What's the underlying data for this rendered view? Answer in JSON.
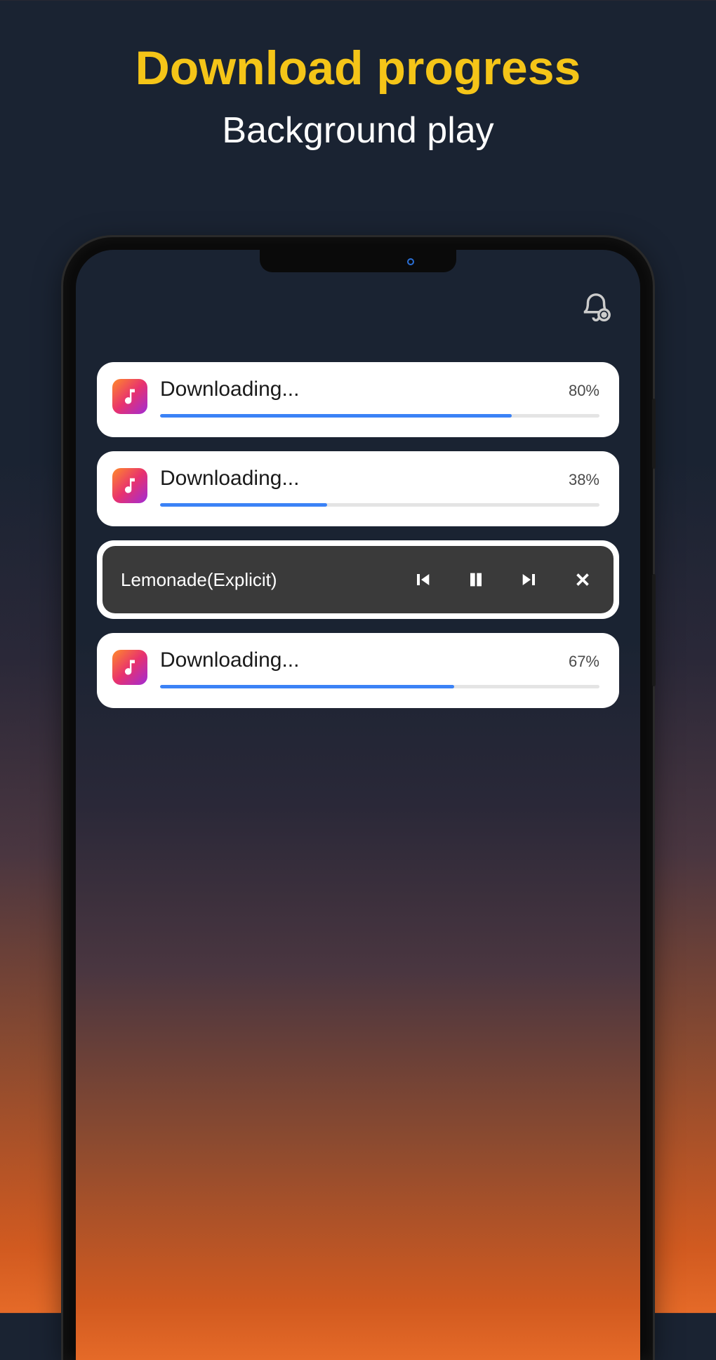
{
  "hero": {
    "title": "Download progress",
    "subtitle": "Background play"
  },
  "downloads": [
    {
      "label": "Downloading...",
      "percent_text": "80%",
      "percent_value": 80
    },
    {
      "label": "Downloading...",
      "percent_text": "38%",
      "percent_value": 38
    },
    {
      "label": "Downloading...",
      "percent_text": "67%",
      "percent_value": 67
    }
  ],
  "player": {
    "title": "Lemonade(Explicit)"
  },
  "colors": {
    "accent_yellow": "#f5c518",
    "progress_blue": "#3b82f6",
    "player_bg": "#3a3a3a"
  }
}
